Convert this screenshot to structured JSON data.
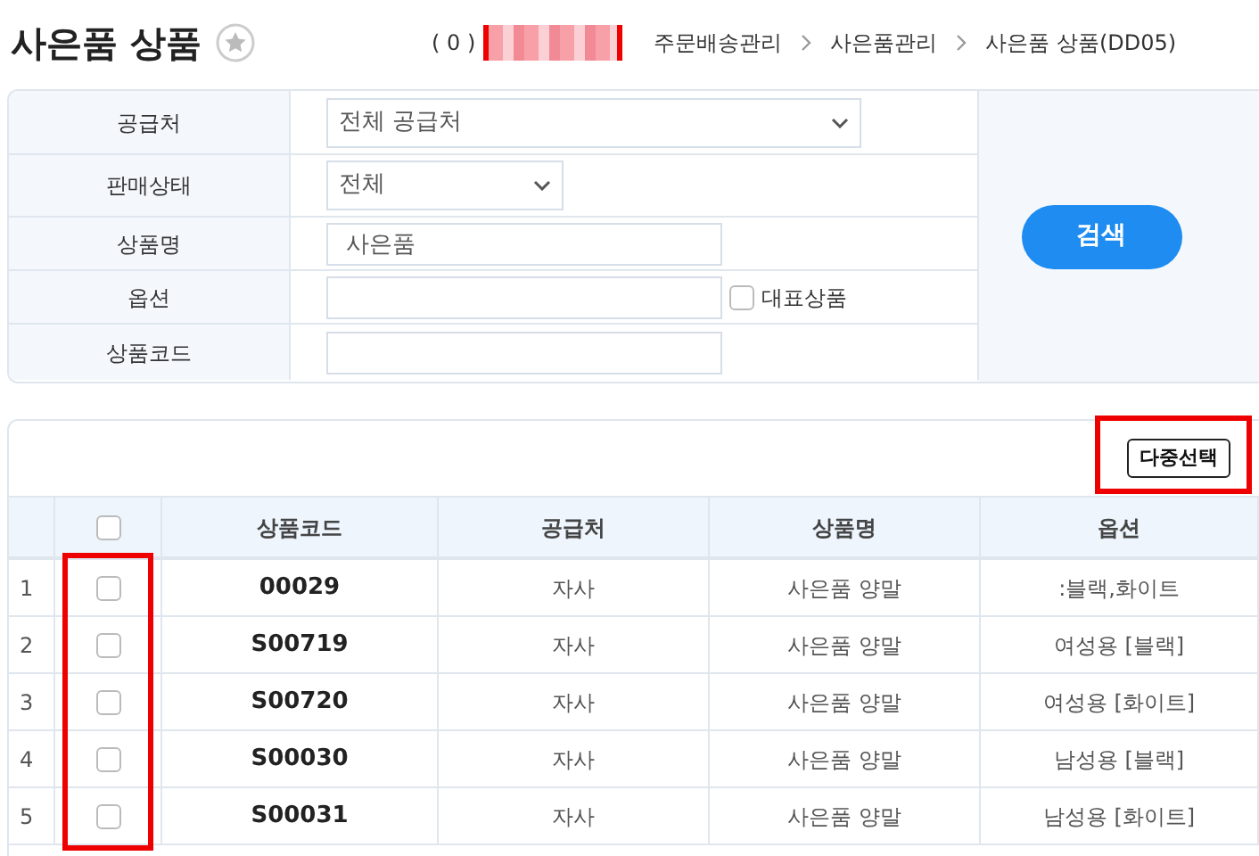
{
  "page_title": "사은품 상품",
  "favorite": false,
  "breadcrumb": {
    "count": "( 0 )",
    "items": [
      "주문배송관리",
      "사은품관리",
      "사은품 상품(DD05)"
    ]
  },
  "filters": [
    {
      "kind": "wide-select",
      "label": "공급처",
      "value": "전체 공급처"
    },
    {
      "kind": "select",
      "label": "판매상태",
      "value": "전체"
    },
    {
      "kind": "input",
      "label": "상품명",
      "value": "사은품"
    },
    {
      "kind": "input-check",
      "label": "옵션",
      "check_label": "대표상품",
      "checked": false
    },
    {
      "kind": "input",
      "label": "상품코드"
    }
  ],
  "search_button": "검색",
  "multi_select_button": "다중선택",
  "table": {
    "select_all_checked": false,
    "columns": [
      "상품코드",
      "공급처",
      "상품명",
      "옵션"
    ],
    "rows": [
      {
        "no": "1",
        "checked": false,
        "cells": [
          "00029",
          "자사",
          "사은품 양말",
          ":블랙,화이트"
        ]
      },
      {
        "no": "2",
        "checked": false,
        "cells": [
          "S00719",
          "자사",
          "사은품 양말",
          "여성용 [블랙]"
        ]
      },
      {
        "no": "3",
        "checked": false,
        "cells": [
          "S00720",
          "자사",
          "사은품 양말",
          "여성용 [화이트]"
        ]
      },
      {
        "no": "4",
        "checked": false,
        "cells": [
          "S00030",
          "자사",
          "사은품 양말",
          "남성용 [블랙]"
        ]
      },
      {
        "no": "5",
        "checked": false,
        "cells": [
          "S00031",
          "자사",
          "사은품 양말",
          "남성용 [화이트]"
        ]
      }
    ]
  }
}
